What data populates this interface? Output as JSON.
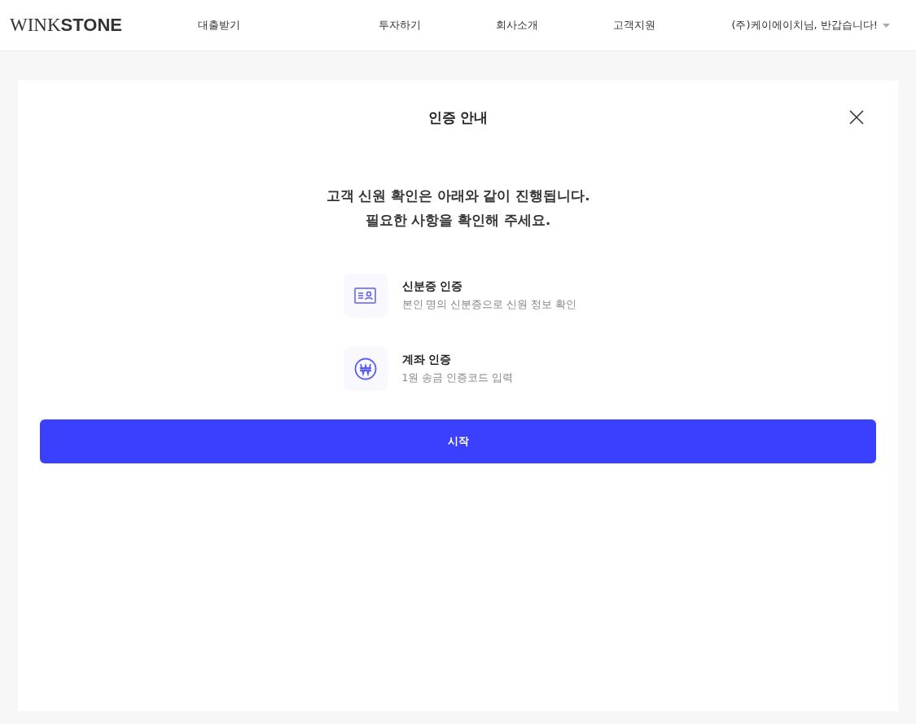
{
  "header": {
    "logo": "WINK**STONE**",
    "nav": [
      {
        "label": "대출받기"
      },
      {
        "label": "투자하기"
      },
      {
        "label": "회사소개"
      },
      {
        "label": "고객지원"
      }
    ],
    "user_greeting": "(주)케이에이치님, 반갑습니다!"
  },
  "dialog": {
    "title": "인증 안내",
    "heading_lines": [
      "고객 신원 확인은 아래와 같이 진행됩니다.",
      "필요한 사항을 확인해 주세요."
    ],
    "steps": [
      {
        "kind": "id-card",
        "title": "신분증 인증",
        "description": "본인 명의 신분증으로 신원 정보 확인"
      },
      {
        "kind": "won",
        "title": "계좌 인증",
        "description": "1원 송금 인증코드 입력"
      }
    ],
    "start_button": "시작"
  }
}
